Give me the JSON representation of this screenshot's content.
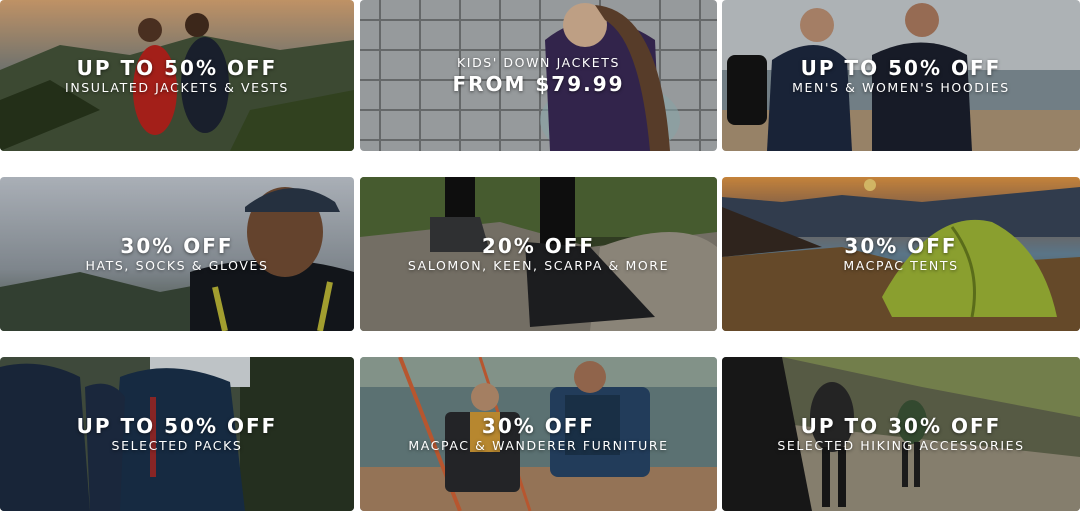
{
  "tiles": [
    {
      "headline": "UP TO 50% OFF",
      "subline": "INSULATED JACKETS & VESTS",
      "order": "headline-first"
    },
    {
      "headline": "FROM $79.99",
      "subline": "KIDS' DOWN JACKETS",
      "order": "subline-first"
    },
    {
      "headline": "UP TO 50% OFF",
      "subline": "MEN'S & WOMEN'S HOODIES",
      "order": "headline-first"
    },
    {
      "headline": "30% OFF",
      "subline": "HATS, SOCKS & GLOVES",
      "order": "headline-first"
    },
    {
      "headline": "20% OFF",
      "subline": "SALOMON, KEEN, SCARPA & MORE",
      "order": "headline-first"
    },
    {
      "headline": "30% OFF",
      "subline": "MACPAC TENTS",
      "order": "headline-first"
    },
    {
      "headline": "UP TO 50% OFF",
      "subline": "SELECTED PACKS",
      "order": "headline-first"
    },
    {
      "headline": "30% OFF",
      "subline": "MACPAC & WANDERER FURNITURE",
      "order": "headline-first"
    },
    {
      "headline": "UP TO 30% OFF",
      "subline": "SELECTED HIKING ACCESSORIES",
      "order": "headline-first"
    }
  ]
}
